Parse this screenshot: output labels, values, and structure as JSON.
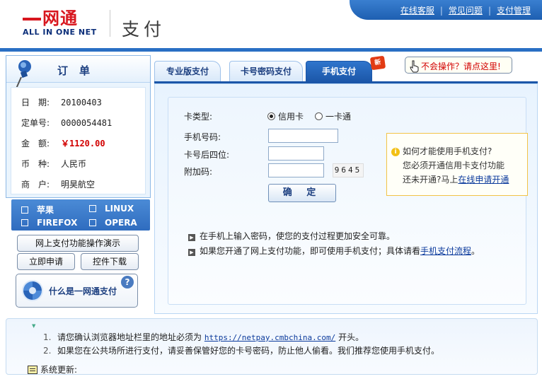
{
  "header": {
    "logo_cn": "网通",
    "logo_en": "ALL IN ONE NET",
    "title": "支付",
    "nav": [
      "在线客服",
      "常见问题",
      "支付管理"
    ]
  },
  "order": {
    "title": "订单",
    "rows": [
      {
        "key": "日　期:",
        "value": "20100403"
      },
      {
        "key": "定单号:",
        "value": "0000054481"
      },
      {
        "key": "金　额:",
        "value": "￥1120.00"
      },
      {
        "key": "币　种:",
        "value": "人民币"
      },
      {
        "key": "商　户:",
        "value": "明昊航空"
      }
    ]
  },
  "browsers": [
    "苹果",
    "LINUX",
    "FIREFOX",
    "OPERA"
  ],
  "sidebar_buttons": {
    "demo": "网上支付功能操作演示",
    "apply": "立即申请",
    "download": "控件下载",
    "what": "什么是一网通支付"
  },
  "tabs": [
    {
      "label": "专业版支付",
      "active": false
    },
    {
      "label": "卡号密码支付",
      "active": false
    },
    {
      "label": "手机支付",
      "active": true
    }
  ],
  "new_badge": "新",
  "help_link": "不会操作？请点这里!",
  "form": {
    "card_type_label": "卡类型:",
    "card_type_options": [
      {
        "label": "信用卡",
        "selected": true
      },
      {
        "label": "一卡通",
        "selected": false
      }
    ],
    "phone_label": "手机号码:",
    "phone_value": "",
    "last4_label": "卡号后四位:",
    "last4_value": "",
    "extra_label": "附加码:",
    "extra_value": "",
    "captcha": "9645",
    "confirm": "确 定"
  },
  "info": {
    "line1": "如何才能使用手机支付?",
    "line2": "您必须开通信用卡支付功能",
    "line3_prefix": "还未开通?马上",
    "line3_link": "在线申请开通"
  },
  "notes": [
    {
      "text": "在手机上输入密码，使您的支付过程更加安全可靠。",
      "link": ""
    },
    {
      "text": "如果您开通了网上支付功能，即可使用手机支付；具体请看",
      "link": "手机支付流程",
      "suffix": "。"
    }
  ],
  "tips": [
    {
      "num": "1.",
      "prefix": "请您确认浏览器地址栏里的地址必须为 ",
      "url": "https://netpay.cmbchina.com/",
      "suffix": " 开头。"
    },
    {
      "num": "2.",
      "prefix": "如果您在公共场所进行支付，请妥善保管好您的卡号密码，防止他人偷看。我们推荐您使用手机支付。",
      "url": "",
      "suffix": ""
    }
  ],
  "update_label": "系统更新:",
  "colors": {
    "brand_blue": "#1b56a8",
    "accent_red": "#d20000",
    "panel_bg": "#e8f3fe"
  }
}
